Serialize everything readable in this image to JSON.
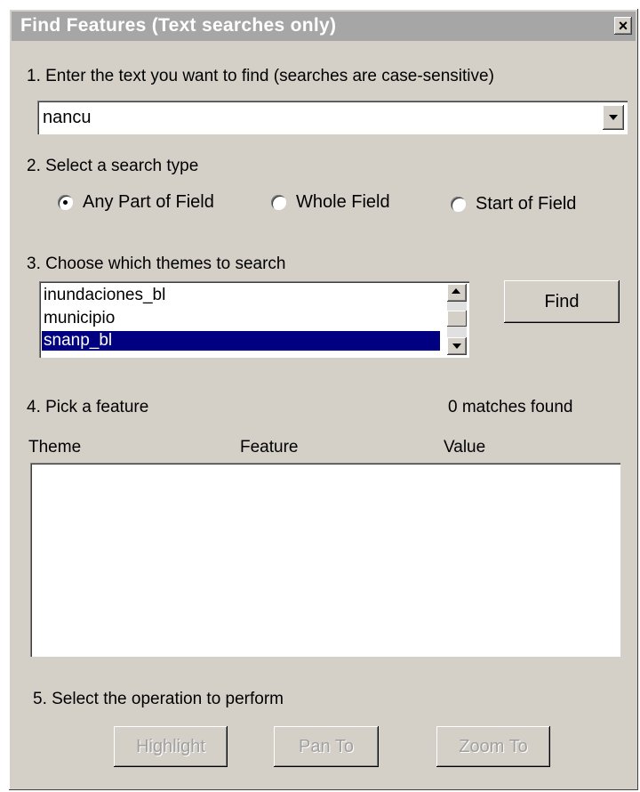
{
  "window": {
    "title": "Find Features (Text searches only)",
    "close_glyph": "×"
  },
  "step1": {
    "label": "1. Enter the text you want to find (searches are case-sensitive)",
    "search_value": "nancu"
  },
  "step2": {
    "label": "2. Select a search type",
    "options": [
      {
        "label": "Any Part of Field",
        "selected": true
      },
      {
        "label": "Whole Field",
        "selected": false
      },
      {
        "label": "Start of Field",
        "selected": false
      }
    ]
  },
  "step3": {
    "label": "3. Choose which themes to search",
    "themes": [
      {
        "label": "inundaciones_bl",
        "selected": false
      },
      {
        "label": "municipio",
        "selected": false
      },
      {
        "label": "snanp_bl",
        "selected": true
      }
    ],
    "find_button": "Find"
  },
  "step4": {
    "label": "4. Pick a feature",
    "matches": "0 matches found",
    "columns": [
      "Theme",
      "Feature",
      "Value"
    ]
  },
  "step5": {
    "label": "5. Select the operation to perform",
    "buttons": [
      "Highlight",
      "Pan To",
      "Zoom To"
    ]
  },
  "colors": {
    "dialog_bg": "#d4d0c8",
    "title_bar": "#a6a6a6",
    "selection": "#000080"
  }
}
